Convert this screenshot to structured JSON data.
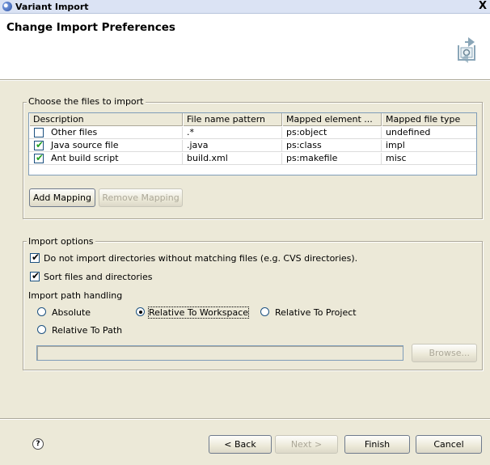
{
  "window": {
    "title": "Variant Import",
    "close_glyph": "X"
  },
  "header": {
    "title": "Change Import Preferences",
    "graphic_icon": "import-wizard-icon"
  },
  "files_group": {
    "legend": "Choose the files to import",
    "columns": [
      "Description",
      "File name pattern",
      "Mapped element ...",
      "Mapped file type"
    ],
    "rows": [
      {
        "checked": false,
        "description": "Other files",
        "pattern": ".*",
        "element": "ps:object",
        "type": "undefined"
      },
      {
        "checked": true,
        "description": "Java source file",
        "pattern": ".java",
        "element": "ps:class",
        "type": "impl"
      },
      {
        "checked": true,
        "description": "Ant build script",
        "pattern": "build.xml",
        "element": "ps:makefile",
        "type": "misc"
      }
    ],
    "add_mapping_label": "Add Mapping",
    "remove_mapping_label": "Remove Mapping"
  },
  "options_group": {
    "legend": "Import options",
    "skip_dirs_label": "Do not import directories without matching files (e.g. CVS directories).",
    "skip_dirs_checked": true,
    "sort_label": "Sort files and directories",
    "sort_checked": true,
    "path_handling_label": "Import path handling",
    "radio_absolute": "Absolute",
    "radio_workspace": "Relative To Workspace",
    "radio_project": "Relative To Project",
    "radio_path": "Relative To Path",
    "selected": "Relative To Workspace",
    "path_value": "",
    "browse_label": "Browse..."
  },
  "footer": {
    "help_glyph": "?",
    "back_label": "< Back",
    "next_label": "Next >",
    "finish_label": "Finish",
    "cancel_label": "Cancel"
  },
  "colors": {
    "dialog_bg": "#ece9d8",
    "header_bg": "#ffffff",
    "check_green": "#21a121"
  }
}
